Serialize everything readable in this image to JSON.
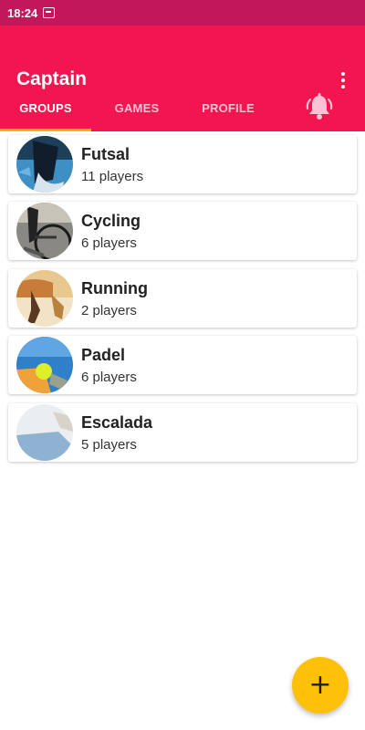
{
  "status_bar": {
    "time": "18:24",
    "notification_icon": "notification-icon"
  },
  "app_bar": {
    "title": "Captain",
    "menu_icon": "more-vert-icon",
    "accent": "#f2154f"
  },
  "tabs": [
    {
      "label": "GROUPS",
      "active": true
    },
    {
      "label": "GAMES",
      "active": false
    },
    {
      "label": "PROFILE",
      "active": false
    }
  ],
  "notifications_icon": "bell-icon",
  "groups": [
    {
      "name": "Futsal",
      "players": "11 players"
    },
    {
      "name": "Cycling",
      "players": "6 players"
    },
    {
      "name": "Running",
      "players": "2 players"
    },
    {
      "name": "Padel",
      "players": "6 players"
    },
    {
      "name": "Escalada",
      "players": "5 players"
    }
  ],
  "fab": {
    "icon": "plus-icon",
    "label": "+",
    "color": "#ffc107"
  }
}
